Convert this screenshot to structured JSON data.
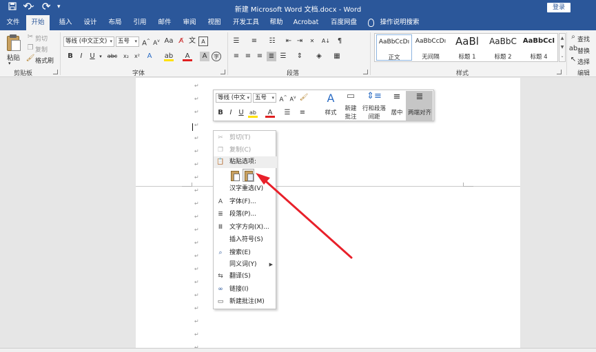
{
  "titlebar": {
    "title": "新建 Microsoft Word 文档.docx  -  Word",
    "login": "登录",
    "save_icon": "save-icon",
    "undo_icon": "undo-icon",
    "redo_icon": "redo-icon",
    "customize_icon": "customize-qat-icon"
  },
  "tabs": [
    "文件",
    "开始",
    "插入",
    "设计",
    "布局",
    "引用",
    "邮件",
    "审阅",
    "视图",
    "开发工具",
    "帮助",
    "Acrobat",
    "百度网盘",
    "操作说明搜索"
  ],
  "active_tab": "开始",
  "clipboard": {
    "paste": "粘贴",
    "cut": "剪切",
    "copy": "复制",
    "format_painter": "格式刷",
    "group_label": "剪贴板"
  },
  "font": {
    "font_name": "等线 (中文正文)",
    "font_size": "五号",
    "group_label": "字体"
  },
  "paragraph": {
    "group_label": "段落"
  },
  "styles": {
    "group_label": "样式",
    "items": [
      {
        "sample": "AaBbCcDı",
        "name": "正文",
        "selected": true
      },
      {
        "sample": "AaBbCcDı",
        "name": "无间隔",
        "selected": false
      },
      {
        "sample": "AaBl",
        "name": "标题 1",
        "selected": false
      },
      {
        "sample": "AaBbC",
        "name": "标题 2",
        "selected": false
      },
      {
        "sample": "AaBbCcI",
        "name": "标题 4",
        "selected": false
      }
    ]
  },
  "editing": {
    "find": "查找",
    "replace": "替换",
    "select": "选择",
    "group_label": "编辑"
  },
  "mini_toolbar": {
    "font_name": "等线 (中文",
    "font_size": "五号",
    "styles": "样式",
    "new_comment_1": "新建",
    "new_comment_2": "批注",
    "line_spacing_1": "行和段落",
    "line_spacing_2": "间距",
    "center": "居中",
    "justify": "两端对齐"
  },
  "context_menu": {
    "cut": "剪切(T)",
    "copy": "复制(C)",
    "paste_options": "粘贴选项:",
    "reconvert": "汉字重选(V)",
    "font": "字体(F)...",
    "paragraph": "段落(P)...",
    "text_direction": "文字方向(X)...",
    "insert_symbol": "插入符号(S)",
    "search": "搜索(E)",
    "synonyms": "同义词(Y)",
    "translate": "翻译(S)",
    "link": "链接(I)",
    "new_comment": "新建批注(M)"
  },
  "colors": {
    "word_blue": "#2b579a",
    "annotation_red": "#e8202a"
  }
}
